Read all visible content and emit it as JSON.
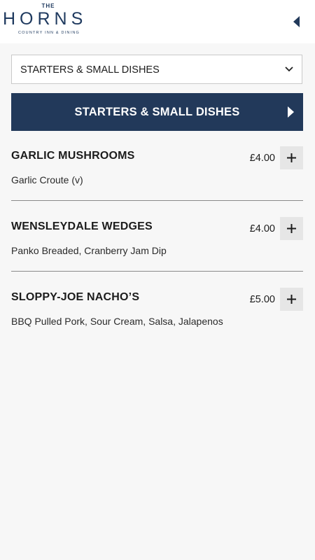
{
  "header": {
    "logo": {
      "the": "THE",
      "name": "HORNS",
      "tagline": "COUNTRY INN & DINING"
    },
    "back_icon": "chevron-left-icon"
  },
  "category_select": {
    "value": "STARTERS & SMALL DISHES",
    "icon": "chevron-down-icon"
  },
  "section": {
    "title": "STARTERS & SMALL DISHES",
    "icon": "caret-right-icon",
    "color": "#22395a"
  },
  "items": [
    {
      "name": "GARLIC MUSHROOMS",
      "description": "Garlic Croute (v)",
      "price": "£4.00"
    },
    {
      "name": "WENSLEYDALE WEDGES",
      "description": "Panko Breaded, Cranberry Jam Dip",
      "price": "£4.00"
    },
    {
      "name": "SLOPPY-JOE NACHO’S",
      "description": "BBQ Pulled Pork, Sour Cream, Salsa, Jalapenos",
      "price": "£5.00"
    }
  ]
}
